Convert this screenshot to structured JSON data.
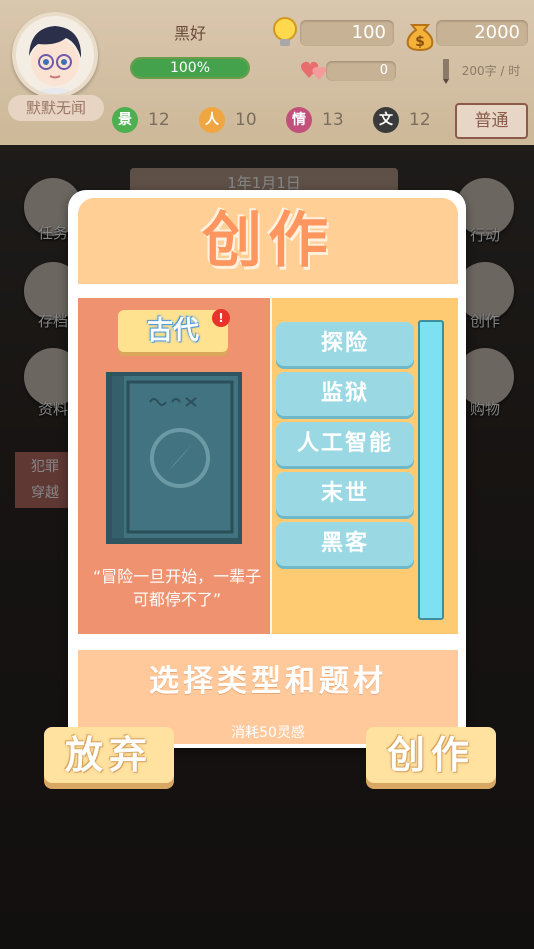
{
  "hud": {
    "username": "默默无闻",
    "status_label": "黑好",
    "progress_text": "100%",
    "progress_fraction": 1.0,
    "inspiration": "100",
    "money": "2000",
    "hearts": "0",
    "speed": "200字 / 时",
    "stats": [
      {
        "glyph": "景",
        "value": "12",
        "color": "#4caf50"
      },
      {
        "glyph": "人",
        "value": "10",
        "color": "#f0a640"
      },
      {
        "glyph": "情",
        "value": "13",
        "color": "#c2507a"
      },
      {
        "glyph": "文",
        "value": "12",
        "color": "#3a3a3a"
      }
    ],
    "difficulty": "普通"
  },
  "scene": {
    "date": "1年1月1日",
    "left_buttons": [
      "任务",
      "存档",
      "资料"
    ],
    "right_buttons": [
      "行动",
      "创作",
      "购物"
    ],
    "crime_tag": [
      "犯罪",
      "穿越"
    ]
  },
  "dialog": {
    "title": "创作",
    "era": "古代",
    "era_alert": "!",
    "quote": "“冒险一旦开始，一辈子可都停不了”",
    "topics": [
      "探险",
      "监狱",
      "人工智能",
      "末世",
      "黑客"
    ],
    "hint": "选择类型和题材",
    "cost": "消耗50灵感",
    "abandon_label": "放弃",
    "create_label": "创作"
  },
  "colors": {
    "title": "#ff9660",
    "left_panel": "#ee9270",
    "right_panel": "#ffcb72",
    "topic_button": "#9ad9e4",
    "scrollbar": "#7ee1f2"
  }
}
